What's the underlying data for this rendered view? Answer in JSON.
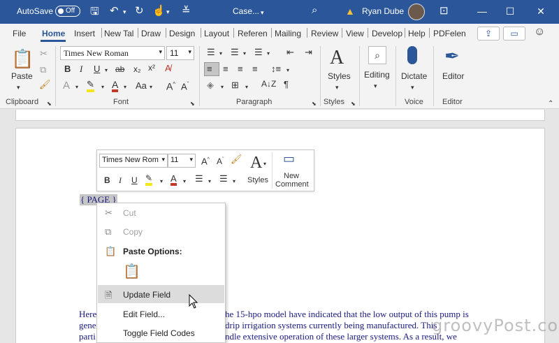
{
  "titlebar": {
    "autosave_label": "AutoSave",
    "autosave_state": "Off",
    "doc_name": "Case...",
    "user_name": "Ryan Dube"
  },
  "tabs": [
    "File",
    "Home",
    "Insert",
    "New Tal",
    "Draw",
    "Design",
    "Layout",
    "Referen",
    "Mailing",
    "Review",
    "View",
    "Develop",
    "Help",
    "PDFelen"
  ],
  "ribbon": {
    "font_name": "Times New Roman",
    "font_size": "11",
    "paste_label": "Paste",
    "styles_label": "Styles",
    "editing_label": "Editing",
    "dictate_label": "Dictate",
    "editor_label": "Editor",
    "groups": {
      "clipboard": "Clipboard",
      "font": "Font",
      "paragraph": "Paragraph",
      "styles": "Styles",
      "voice": "Voice",
      "editor": "Editor"
    }
  },
  "mini_toolbar": {
    "font_name": "Times New Rom",
    "font_size": "11",
    "styles_label": "Styles",
    "new_comment_line1": "New",
    "new_comment_line2": "Comment"
  },
  "document": {
    "field_code": "{ PAGE }",
    "lines": [
      "Here",
      "he 15-hpo model have indicated that the low output of this pump is",
      "gene",
      "drip irrigation systems  currently being manufactured.  This",
      "parti",
      "ndle extensive operation of these larger systems.  As a result, we"
    ]
  },
  "context_menu": {
    "cut": "Cut",
    "copy": "Copy",
    "paste_options": "Paste Options:",
    "update_field": "Update Field",
    "edit_field": "Edit Field...",
    "toggle_field_codes": "Toggle Field Codes"
  },
  "watermark": "groovyPost.com",
  "colors": {
    "titlebar": "#2b579a",
    "field_highlight": "#c6c6c6",
    "menu_highlight": "#dcdcdc",
    "text_color": "#1a1a80"
  }
}
